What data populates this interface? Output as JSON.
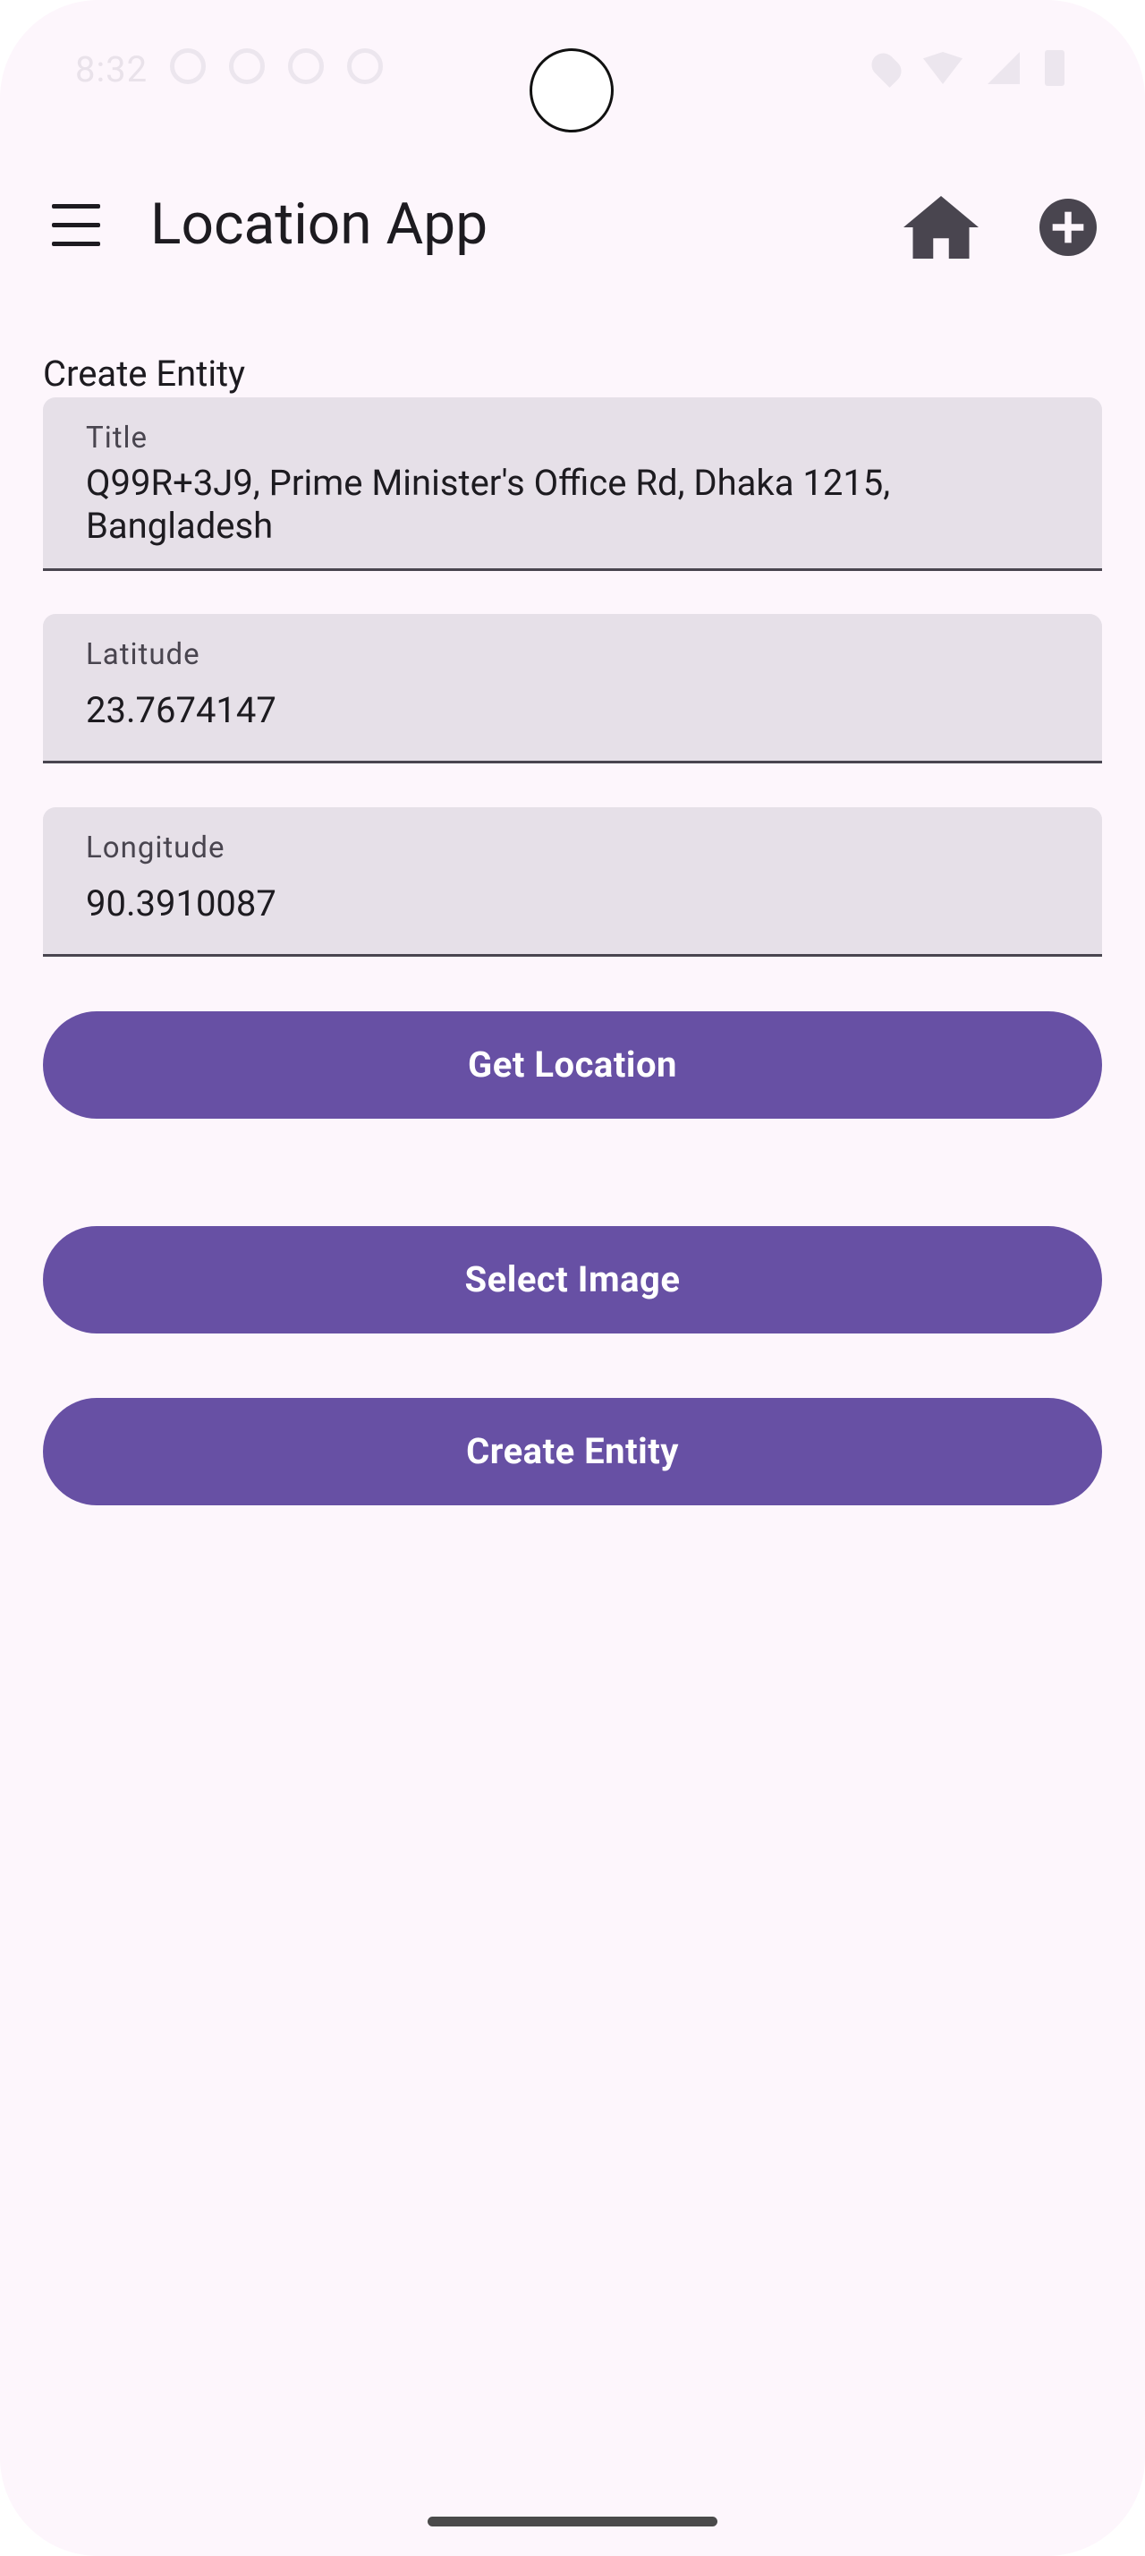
{
  "status_bar": {
    "time": "8:32"
  },
  "app_bar": {
    "title": "Location App",
    "menu_icon": "menu-icon",
    "home_icon": "home-icon",
    "add_icon": "add-circle-icon"
  },
  "form": {
    "section_label": "Create Entity",
    "title_field": {
      "label": "Title",
      "value": "Q99R+3J9, Prime Minister's Office Rd, Dhaka 1215, Bangladesh"
    },
    "latitude_field": {
      "label": "Latitude",
      "value": "23.7674147"
    },
    "longitude_field": {
      "label": "Longitude",
      "value": "90.3910087"
    }
  },
  "buttons": {
    "get_location": "Get Location",
    "select_image": "Select Image",
    "create_entity": "Create Entity"
  },
  "colors": {
    "background": "#fdf6fc",
    "primary": "#6750a4",
    "field_background": "#e6e0e8",
    "on_surface": "#1d1b20"
  }
}
